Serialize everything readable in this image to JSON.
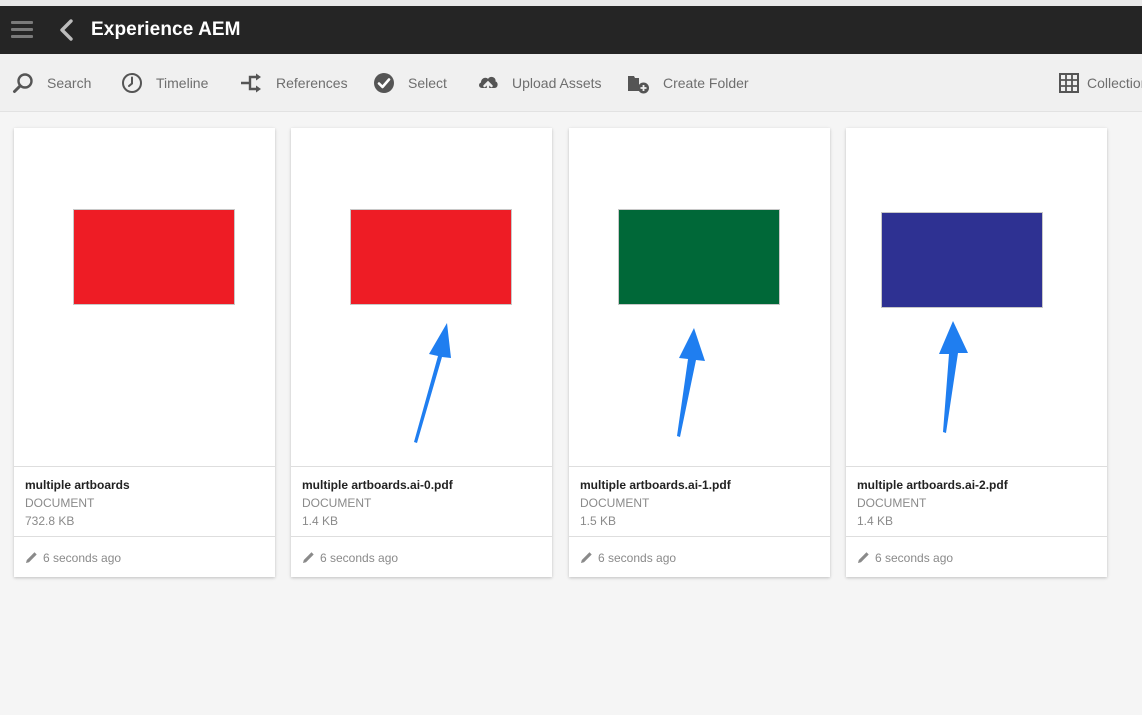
{
  "header": {
    "title": "Experience AEM",
    "menu_icon": "hamburger-menu-icon",
    "back_icon": "chevron-left-icon"
  },
  "actionbar": {
    "search_label": "Search",
    "timeline_label": "Timeline",
    "references_label": "References",
    "select_label": "Select",
    "upload_label": "Upload Assets",
    "create_folder_label": "Create Folder",
    "collections_label": "Collections"
  },
  "colors": {
    "header_bg": "#252525",
    "red": "#ee1c25",
    "green": "#006838",
    "blue": "#2e3192",
    "arrow": "#1f7ef0"
  },
  "cards": [
    {
      "name": "multiple artboards",
      "type": "DOCUMENT",
      "size": "732.8 KB",
      "modified": "6 seconds ago",
      "swatch": "#ee1c25",
      "highlighted": false
    },
    {
      "name": "multiple artboards.ai-0.pdf",
      "type": "DOCUMENT",
      "size": "1.4 KB",
      "modified": "6 seconds ago",
      "swatch": "#ee1c25",
      "highlighted": true
    },
    {
      "name": "multiple artboards.ai-1.pdf",
      "type": "DOCUMENT",
      "size": "1.5 KB",
      "modified": "6 seconds ago",
      "swatch": "#006838",
      "highlighted": true
    },
    {
      "name": "multiple artboards.ai-2.pdf",
      "type": "DOCUMENT",
      "size": "1.4 KB",
      "modified": "6 seconds ago",
      "swatch": "#2e3192",
      "highlighted": true
    }
  ]
}
